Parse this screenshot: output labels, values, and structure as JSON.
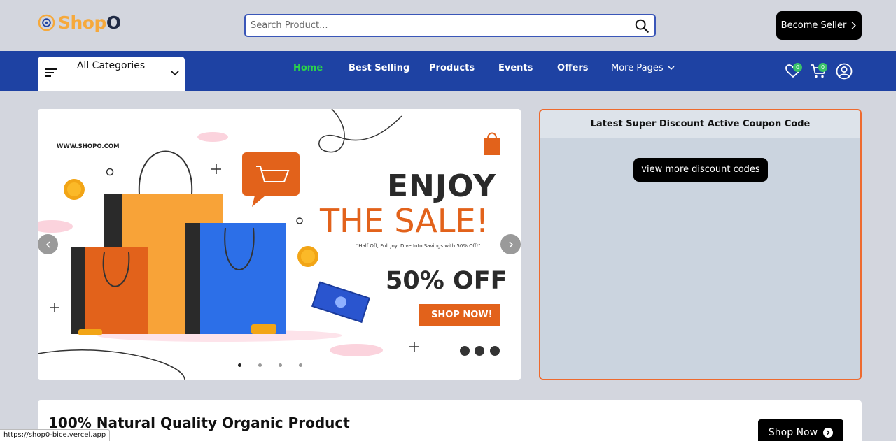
{
  "header": {
    "logo": {
      "part1": "Shop",
      "part2": "O"
    },
    "search": {
      "placeholder": "Search Product..."
    },
    "become_seller": "Become Seller"
  },
  "navbar": {
    "categories_label": "All Categories",
    "links": [
      "Home",
      "Best Selling",
      "Products",
      "Events",
      "Offers",
      "More Pages"
    ],
    "active": "Home",
    "wishlist_count": "0",
    "cart_count": "0"
  },
  "hero": {
    "banner": {
      "site": "WWW.SHOPO.COM",
      "headline1": "ENJOY",
      "headline2": "THE SALE!",
      "tagline": "\"Half Off, Full Joy: Dive Into Savings with 50% Off!\"",
      "offer": "50% OFF",
      "cta": "SHOP NOW!"
    },
    "slides_total": 4,
    "slide_active": 1
  },
  "coupon": {
    "title": "Latest Super Discount Active Coupon Code",
    "button": "view more discount codes"
  },
  "organic": {
    "title": "100% Natural Quality Organic Product",
    "button": "Shop Now"
  },
  "status_url": "https://shop0-bice.vercel.app",
  "colors": {
    "nav_bg": "#1e42a3",
    "active_link": "#2bd44a",
    "accent_orange": "#ee6a2e",
    "logo_orange": "#f6a93b",
    "page_bg": "#d3d6de"
  }
}
